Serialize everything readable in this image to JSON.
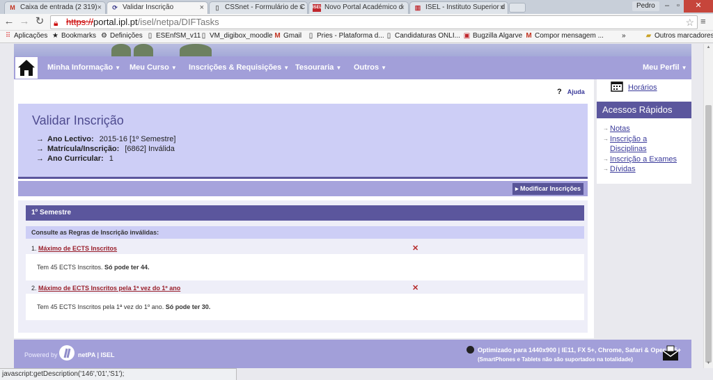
{
  "browser": {
    "tabs": [
      {
        "title": "Caixa de entrada (2 319)",
        "icon": "gmail-icon",
        "active": false
      },
      {
        "title": "Validar Inscrição",
        "icon": "ipl-icon",
        "active": true
      },
      {
        "title": "CSSnet - Formulário de C",
        "icon": "page-icon",
        "active": false
      },
      {
        "title": "Novo Portal Académico d",
        "icon": "isel-icon",
        "active": false
      },
      {
        "title": "ISEL - Instituto Superior d",
        "icon": "isel-icon",
        "active": false
      }
    ],
    "profile_name": "Pedro",
    "url_scheme": "https://",
    "url_host": "portal.ipl.pt",
    "url_path": "/isel/netpa/DIFTasks",
    "bookmarks": [
      "Aplicações",
      "Bookmarks",
      "Definições",
      "ESEnfSM_v11",
      "VM_digibox_moodle",
      "Gmail",
      "Pries - Plataforma d...",
      "Candidaturas ONLI...",
      "Bugzilla Algarve",
      "Compor mensagem ...",
      "»",
      "Outros marcadores"
    ],
    "status_text": "javascript:getDescription('146','01','S1');"
  },
  "nav": {
    "items": [
      "Minha Informação",
      "Meu Curso",
      "Inscrições & Requisições",
      "Tesouraria",
      "Outros"
    ],
    "profile": "Meu Perfil",
    "caret": "▼"
  },
  "help_label": "Ajuda",
  "help_icon": "?",
  "page": {
    "title": "Validar Inscrição",
    "fields": [
      {
        "label": "Ano Lectivo:",
        "value": "2015-16 [1º Semestre]"
      },
      {
        "label": "Matrícula/Inscrição:",
        "value": "[6862] Inválida"
      },
      {
        "label": "Ano Curricular:",
        "value": "1"
      }
    ],
    "modify_button": "Modificar Inscrições"
  },
  "semester": {
    "header": "1º Semestre",
    "subheader": "Consulte as Regras de Inscrição inválidas:",
    "rules": [
      {
        "number": "1.",
        "title": "Máximo de ECTS Inscritos",
        "status_icon": "✕",
        "body_text": "Tem 45 ECTS Inscritos.",
        "body_bold": "Só pode ter 44."
      },
      {
        "number": "2.",
        "title": "Máximo de ECTS Inscritos pela 1ª vez do 1º ano",
        "status_icon": "✕",
        "body_text": "Tem 45 ECTS Inscritos pela 1ª vez do 1º ano.",
        "body_bold": "Só pode ter 30."
      }
    ]
  },
  "sidebar": {
    "horarios": "Horários",
    "quick_title": "Acessos Rápidos",
    "quick_links": [
      "Notas",
      "Inscrição a",
      "Disciplinas",
      "Inscrição a Exames",
      "Dívidas"
    ]
  },
  "footer": {
    "powered_by": "Powered by",
    "brand": "netPA | ISEL",
    "optimized": "Optimizado para 1440x900 | IE11, FX 5+, Chrome, Safari & Opera 15+",
    "note": "(SmartPhones e Tablets não são suportados na totalidade)"
  },
  "colors": {
    "nav_bg": "#a29fd9",
    "header_dark": "#5b569d",
    "panel_light": "#cdcef6",
    "error_red": "#9a1f2b"
  }
}
